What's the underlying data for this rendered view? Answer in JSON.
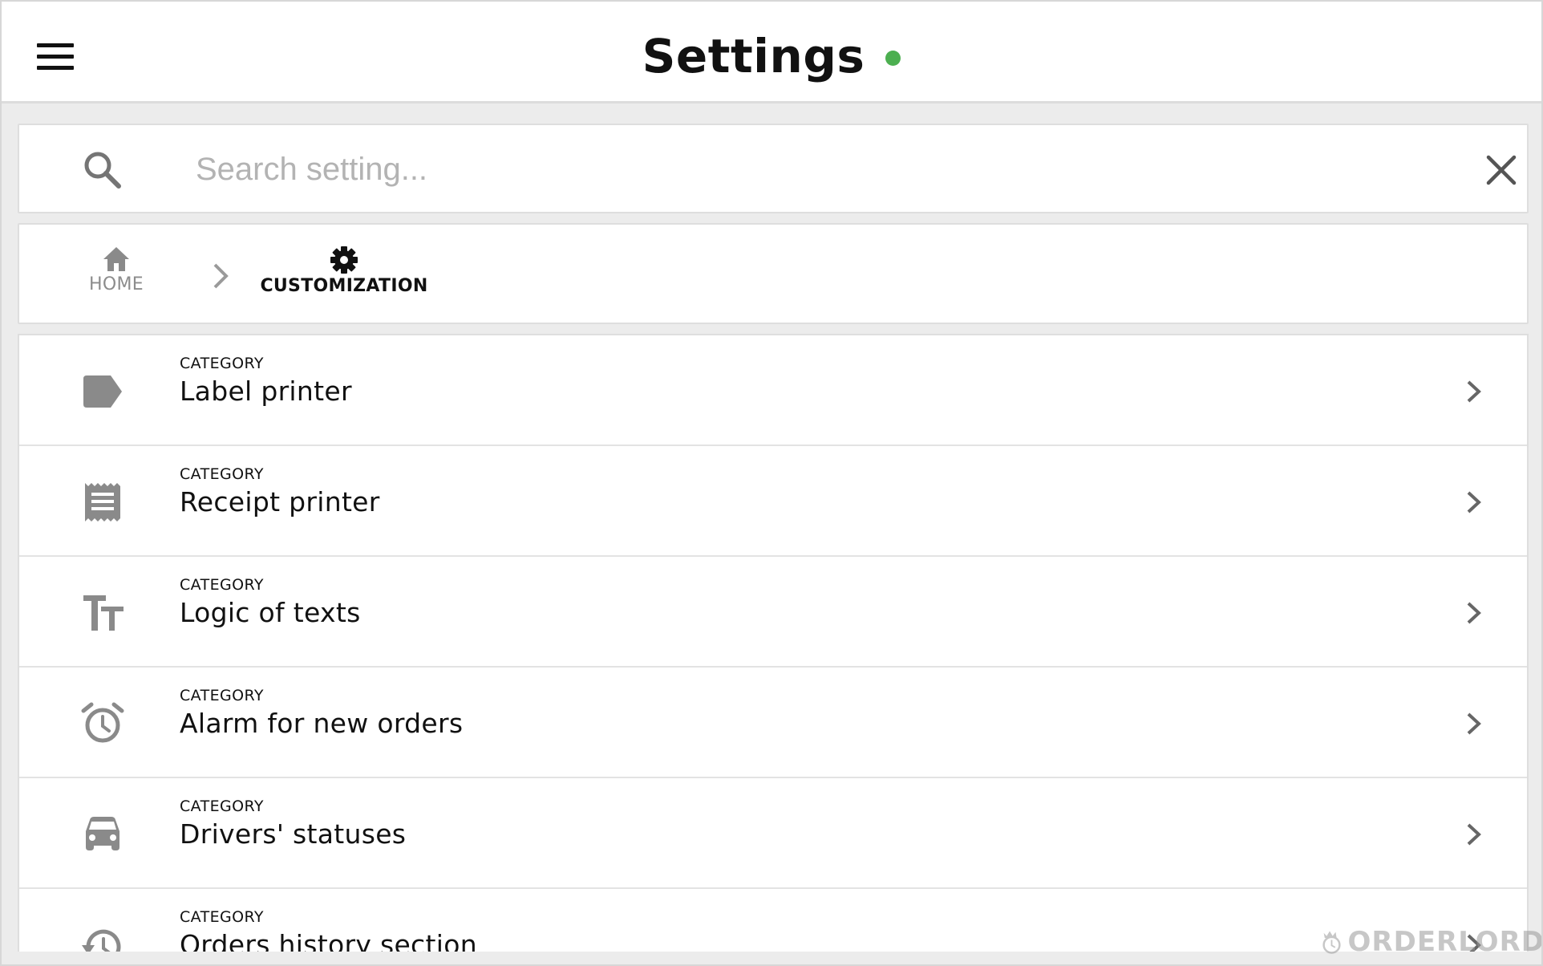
{
  "header": {
    "title": "Settings",
    "status_color": "#4caf50",
    "menu_icon": "hamburger-menu-icon"
  },
  "search": {
    "placeholder": "Search setting...",
    "value": "",
    "search_icon": "search-icon",
    "clear_icon": "close-icon"
  },
  "breadcrumb": {
    "items": [
      {
        "label": "HOME",
        "icon": "home-icon"
      },
      {
        "label": "CUSTOMIZATION",
        "icon": "gear-icon"
      }
    ],
    "separator_icon": "chevron-right-icon"
  },
  "categories": [
    {
      "kicker": "CATEGORY",
      "title": "Label printer",
      "icon": "label-icon"
    },
    {
      "kicker": "CATEGORY",
      "title": "Receipt printer",
      "icon": "receipt-icon"
    },
    {
      "kicker": "CATEGORY",
      "title": "Logic of texts",
      "icon": "text-size-icon"
    },
    {
      "kicker": "CATEGORY",
      "title": "Alarm for new orders",
      "icon": "alarm-icon"
    },
    {
      "kicker": "CATEGORY",
      "title": "Drivers' statuses",
      "icon": "car-icon"
    },
    {
      "kicker": "CATEGORY",
      "title": "Orders history section",
      "icon": "history-icon"
    }
  ],
  "watermark": {
    "text": "ORDERLORD"
  },
  "colors": {
    "icon_gray": "#8a8a8a",
    "accent_green": "#4caf50"
  }
}
